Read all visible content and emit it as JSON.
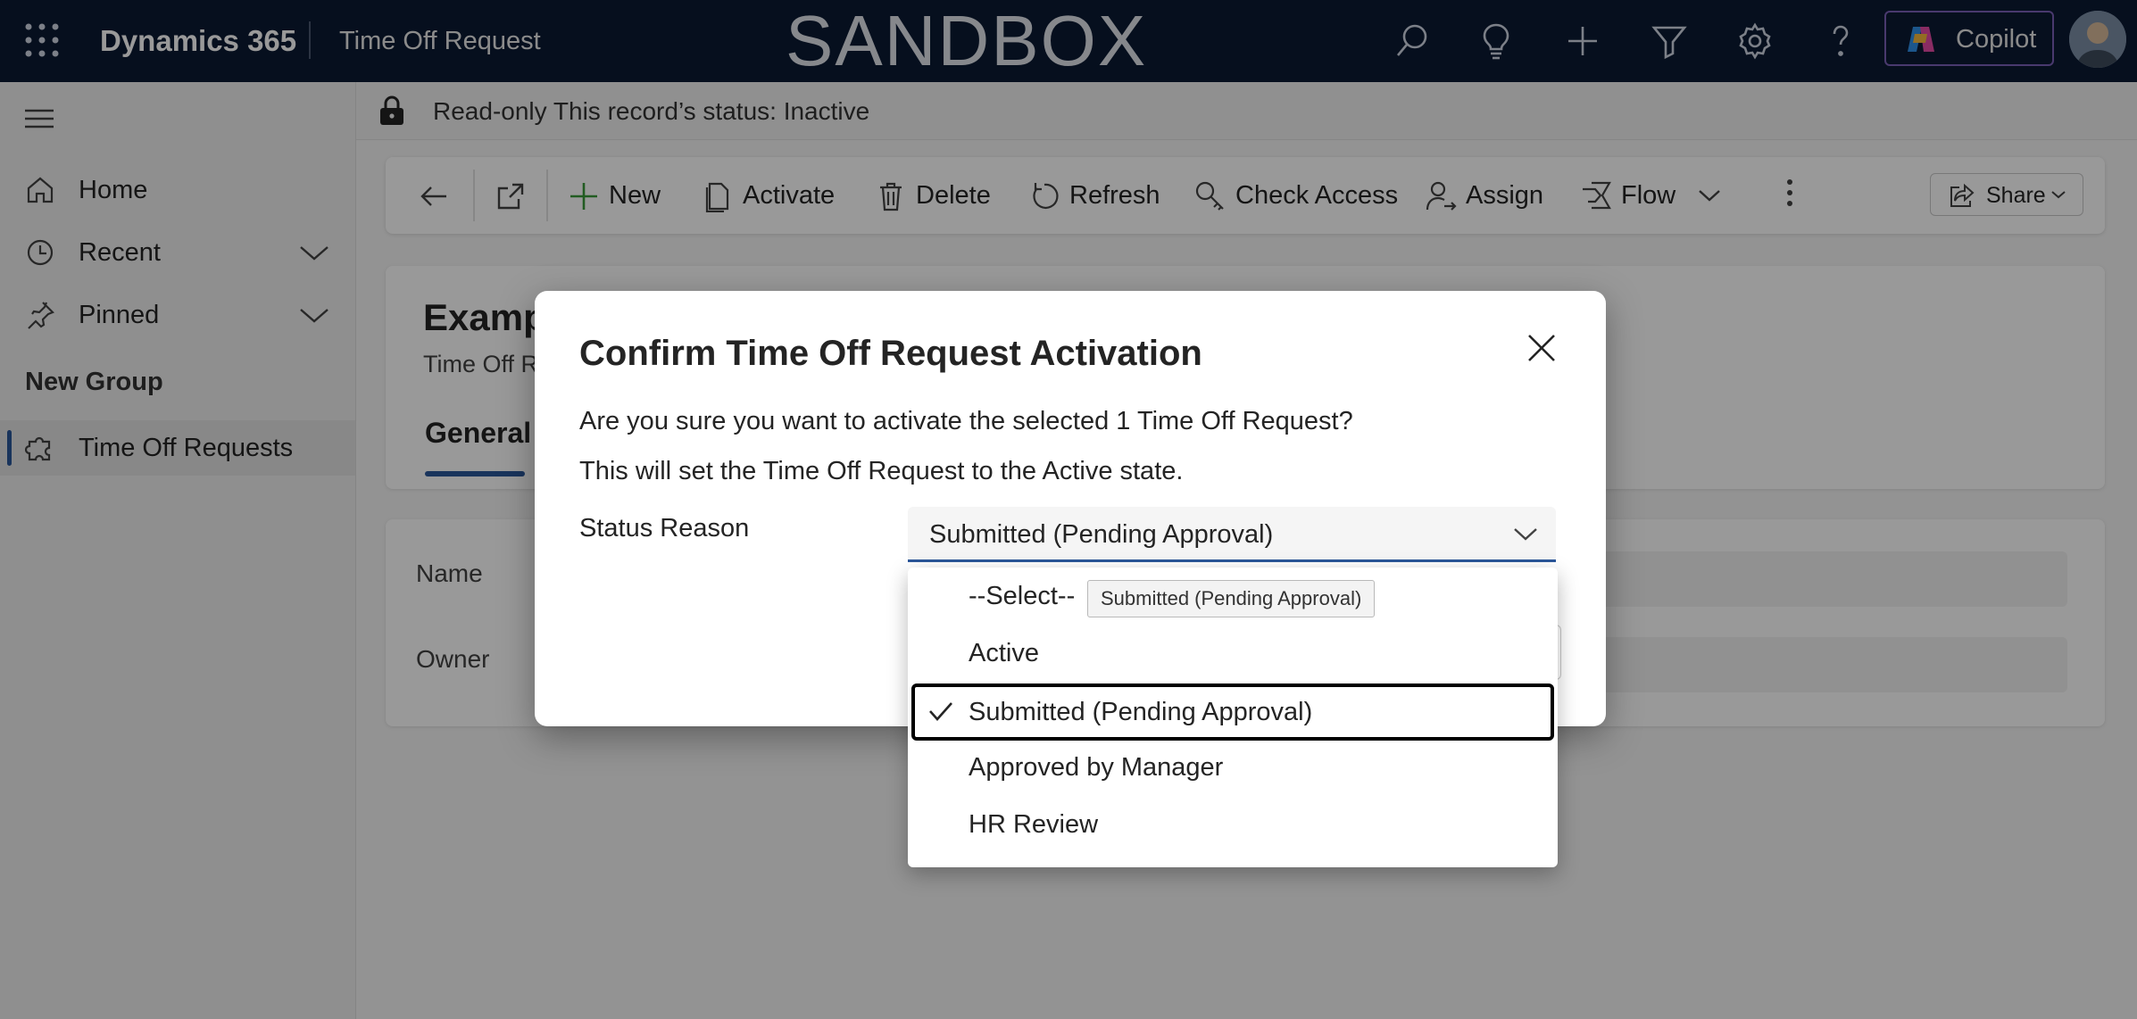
{
  "topbar": {
    "app_name": "Dynamics 365",
    "page_name": "Time Off Request",
    "environment_banner": "SANDBOX",
    "copilot_label": "Copilot",
    "icons": [
      "waffle-icon",
      "search-icon",
      "lightbulb-icon",
      "plus-icon",
      "filter-icon",
      "gear-icon",
      "help-icon",
      "copilot-icon",
      "avatar"
    ]
  },
  "sidebar": {
    "items": [
      {
        "label": "Home",
        "icon": "home-icon"
      },
      {
        "label": "Recent",
        "icon": "clock-icon"
      },
      {
        "label": "Pinned",
        "icon": "pin-icon"
      }
    ],
    "group_label": "New Group",
    "group_items": [
      {
        "label": "Time Off Requests",
        "icon": "puzzle-icon",
        "selected": true
      }
    ]
  },
  "readonly_bar": {
    "text": "Read-only  This record’s status: Inactive"
  },
  "command_bar": {
    "new_label": "New",
    "activate_label": "Activate",
    "delete_label": "Delete",
    "refresh_label": "Refresh",
    "check_access_label": "Check Access",
    "assign_label": "Assign",
    "flow_label": "Flow",
    "share_label": "Share"
  },
  "form": {
    "record_title": "Examp",
    "entity_name": "Time Off R",
    "tab_general": "General",
    "fields": [
      {
        "label": "Name"
      },
      {
        "label": "Owner"
      }
    ]
  },
  "dialog": {
    "title": "Confirm Time Off Request Activation",
    "message_1": "Are you sure you want to activate the selected 1 Time Off Request?",
    "message_2": "This will set the Time Off Request to the Active state.",
    "status_reason_label": "Status Reason",
    "status_reason_value": "Submitted (Pending Approval)",
    "options": [
      {
        "label": "--Select--",
        "selected": false
      },
      {
        "label": "Active",
        "selected": false
      },
      {
        "label": "Submitted (Pending Approval)",
        "selected": true
      },
      {
        "label": "Approved by Manager",
        "selected": false
      },
      {
        "label": "HR Review",
        "selected": false
      }
    ],
    "tooltip": "Submitted (Pending Approval)"
  },
  "colors": {
    "topbar_bg": "#0b1a33",
    "accent": "#2b579a",
    "overlay": "rgba(0,0,0,0.40)"
  }
}
